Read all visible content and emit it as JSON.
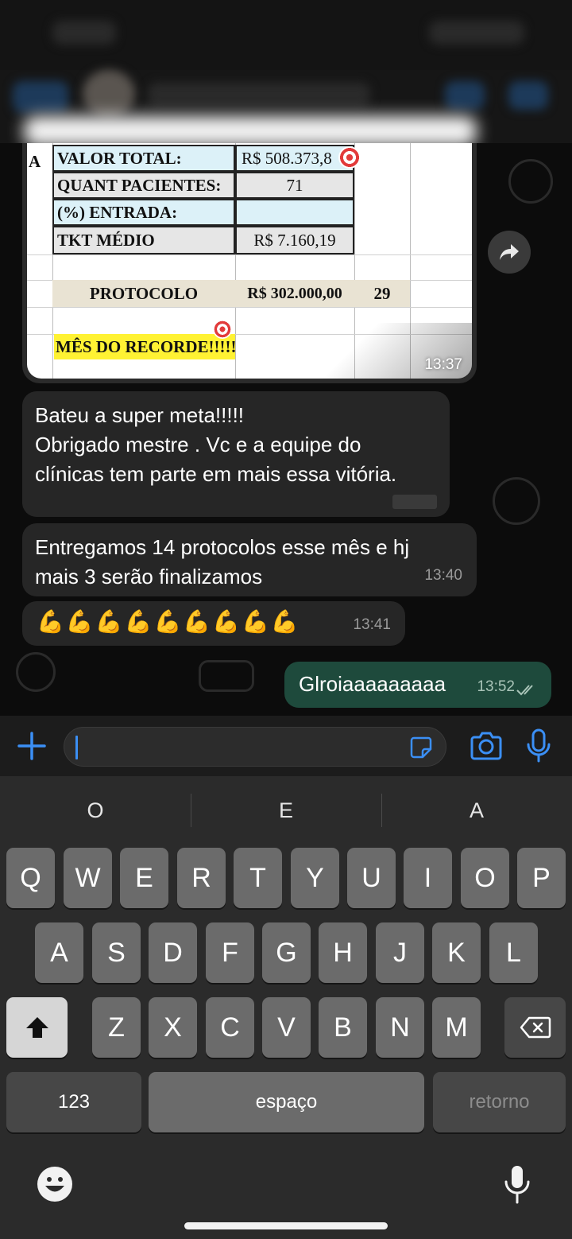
{
  "chat": {
    "image_message": {
      "time": "13:37",
      "sheet": {
        "col_letter": "A",
        "rows": [
          {
            "label": "VALOR TOTAL:",
            "value": "R$ 508.373,8",
            "extra": ""
          },
          {
            "label": "QUANT PACIENTES:",
            "value": "71",
            "extra": ""
          },
          {
            "label": "(%) ENTRADA:",
            "value": "",
            "extra": ""
          },
          {
            "label": "TKT MÉDIO",
            "value": "R$ 7.160,19",
            "extra": ""
          },
          {
            "label": "PROTOCOLO",
            "value": "R$ 302.000,00",
            "extra": "29"
          },
          {
            "label": "MÊS DO RECORDE!!!!!",
            "value": "",
            "extra": ""
          }
        ]
      }
    },
    "messages": [
      {
        "text_lines": [
          "Bateu a super meta!!!!!",
          "Obrigado mestre . Vc e a equipe do",
          "clínicas tem parte em mais essa vitória."
        ],
        "time": ""
      },
      {
        "text_lines": [
          "Entregamos 14 protocolos esse mês e hj",
          "mais 3 serão finalizamos"
        ],
        "time": "13:40"
      },
      {
        "emoji": "💪💪💪💪💪💪💪💪💪",
        "time": "13:41"
      },
      {
        "text": "Glroiaaaaaaaaa",
        "time": "13:52",
        "outgoing": true
      }
    ]
  },
  "keyboard": {
    "suggestions": [
      "O",
      "E",
      "A"
    ],
    "row1": [
      "Q",
      "W",
      "E",
      "R",
      "T",
      "Y",
      "U",
      "I",
      "O",
      "P"
    ],
    "row2": [
      "A",
      "S",
      "D",
      "F",
      "G",
      "H",
      "J",
      "K",
      "L"
    ],
    "row3": [
      "Z",
      "X",
      "C",
      "V",
      "B",
      "N",
      "M"
    ],
    "numbers_label": "123",
    "space_label": "espaço",
    "return_label": "retorno"
  },
  "colors": {
    "outgoing_bubble": "#1e4a3c",
    "incoming_bubble": "#262626",
    "accent_blue": "#3b8ff5"
  }
}
